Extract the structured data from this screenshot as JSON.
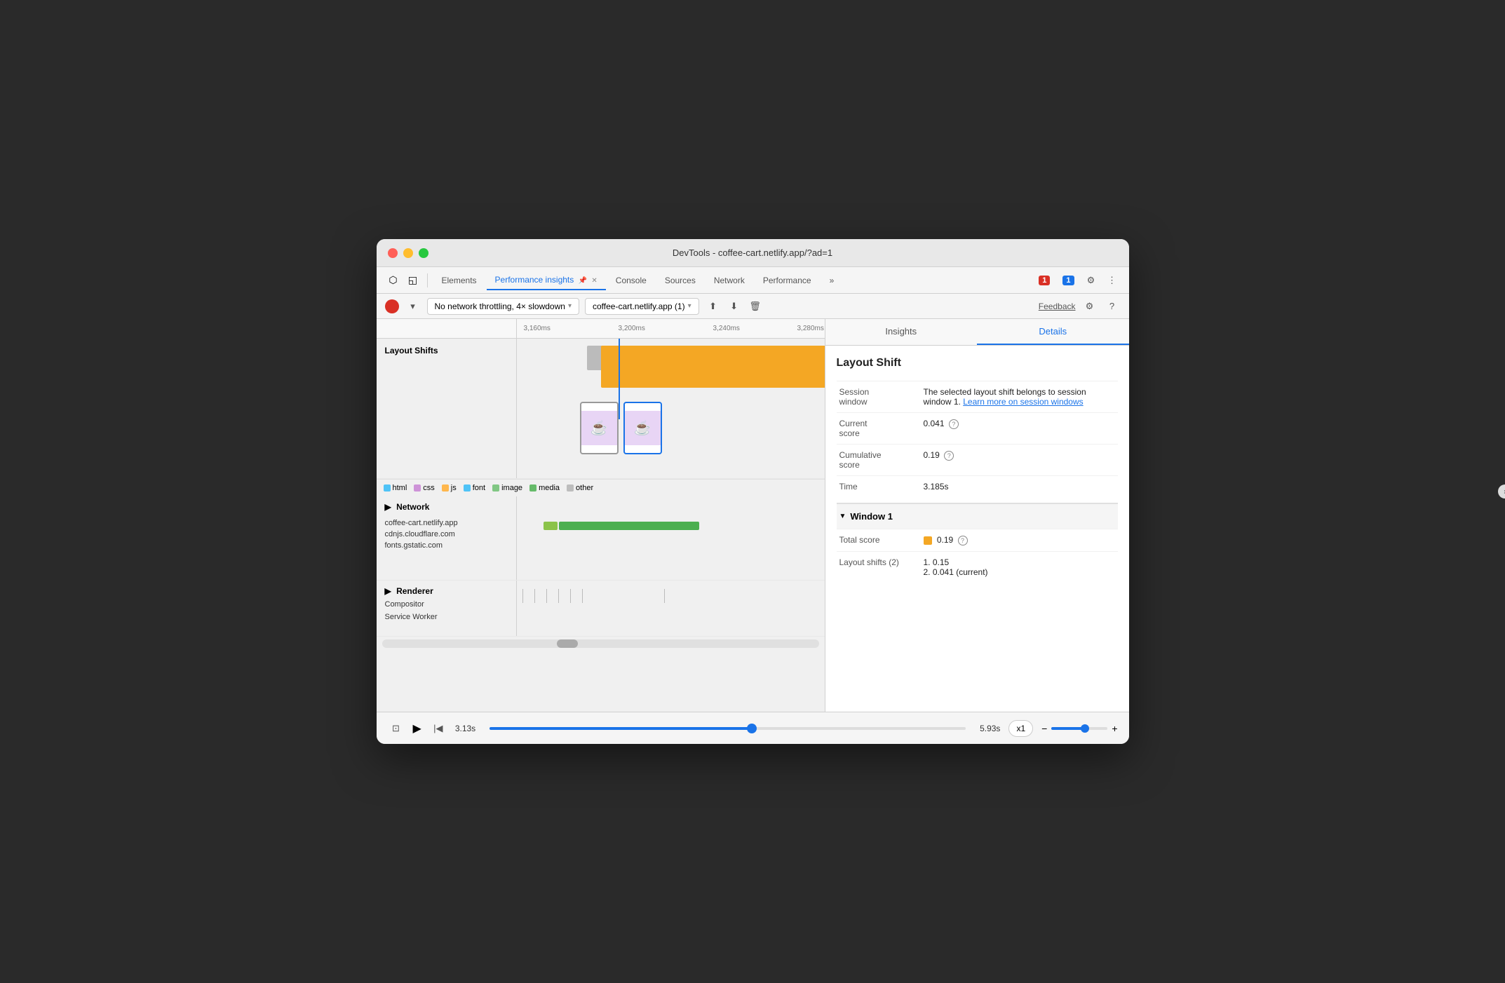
{
  "window": {
    "title": "DevTools - coffee-cart.netlify.app/?ad=1"
  },
  "tabs": {
    "items": [
      {
        "label": "Elements",
        "active": false
      },
      {
        "label": "Performance insights",
        "active": true,
        "pinned": true,
        "closeable": true
      },
      {
        "label": "Console",
        "active": false
      },
      {
        "label": "Sources",
        "active": false
      },
      {
        "label": "Network",
        "active": false
      },
      {
        "label": "Performance",
        "active": false
      },
      {
        "label": "»",
        "active": false
      }
    ]
  },
  "toolbar": {
    "error_count": "1",
    "info_count": "1",
    "feedback_label": "Feedback",
    "throttle_label": "No network throttling, 4× slowdown",
    "target_label": "coffee-cart.netlify.app (1)"
  },
  "ruler": {
    "marks": [
      "3,160ms",
      "3,200ms",
      "3,240ms",
      "3,280ms"
    ]
  },
  "sections": {
    "layout_shifts": "Layout Shifts",
    "network": "Network",
    "renderer": "Renderer",
    "compositor": "Compositor",
    "service_worker": "Service Worker"
  },
  "legend": {
    "items": [
      {
        "label": "html",
        "color": "#4fc3f7"
      },
      {
        "label": "css",
        "color": "#ce93d8"
      },
      {
        "label": "js",
        "color": "#ffb74d"
      },
      {
        "label": "font",
        "color": "#4fc3f7"
      },
      {
        "label": "image",
        "color": "#81c784"
      },
      {
        "label": "media",
        "color": "#66bb6a"
      },
      {
        "label": "other",
        "color": "#bdbdbd"
      }
    ]
  },
  "network_hosts": [
    "coffee-cart.netlify.app",
    "cdnjs.cloudflare.com",
    "fonts.gstatic.com"
  ],
  "right_panel": {
    "tabs": [
      "Insights",
      "Details"
    ],
    "active_tab": "Details",
    "section_title": "Layout Shift",
    "session_window_label": "Session window",
    "session_window_value": "The selected layout shift belongs to session window 1.",
    "session_window_link": "Learn more on session windows",
    "current_score_label": "Current score",
    "current_score_value": "0.041",
    "cumulative_score_label": "Cumulative score",
    "cumulative_score_value": "0.19",
    "time_label": "Time",
    "time_value": "3.185s",
    "window_section_title": "Window 1",
    "total_score_label": "Total score",
    "total_score_value": "0.19",
    "layout_shifts_label": "Layout shifts (2)",
    "layout_shift_1": "1. 0.15",
    "layout_shift_2": "2. 0.041 (current)"
  },
  "bottom_bar": {
    "time_start": "3.13s",
    "time_end": "5.93s",
    "speed": "x1",
    "zoom_minus": "−",
    "zoom_plus": "+"
  }
}
